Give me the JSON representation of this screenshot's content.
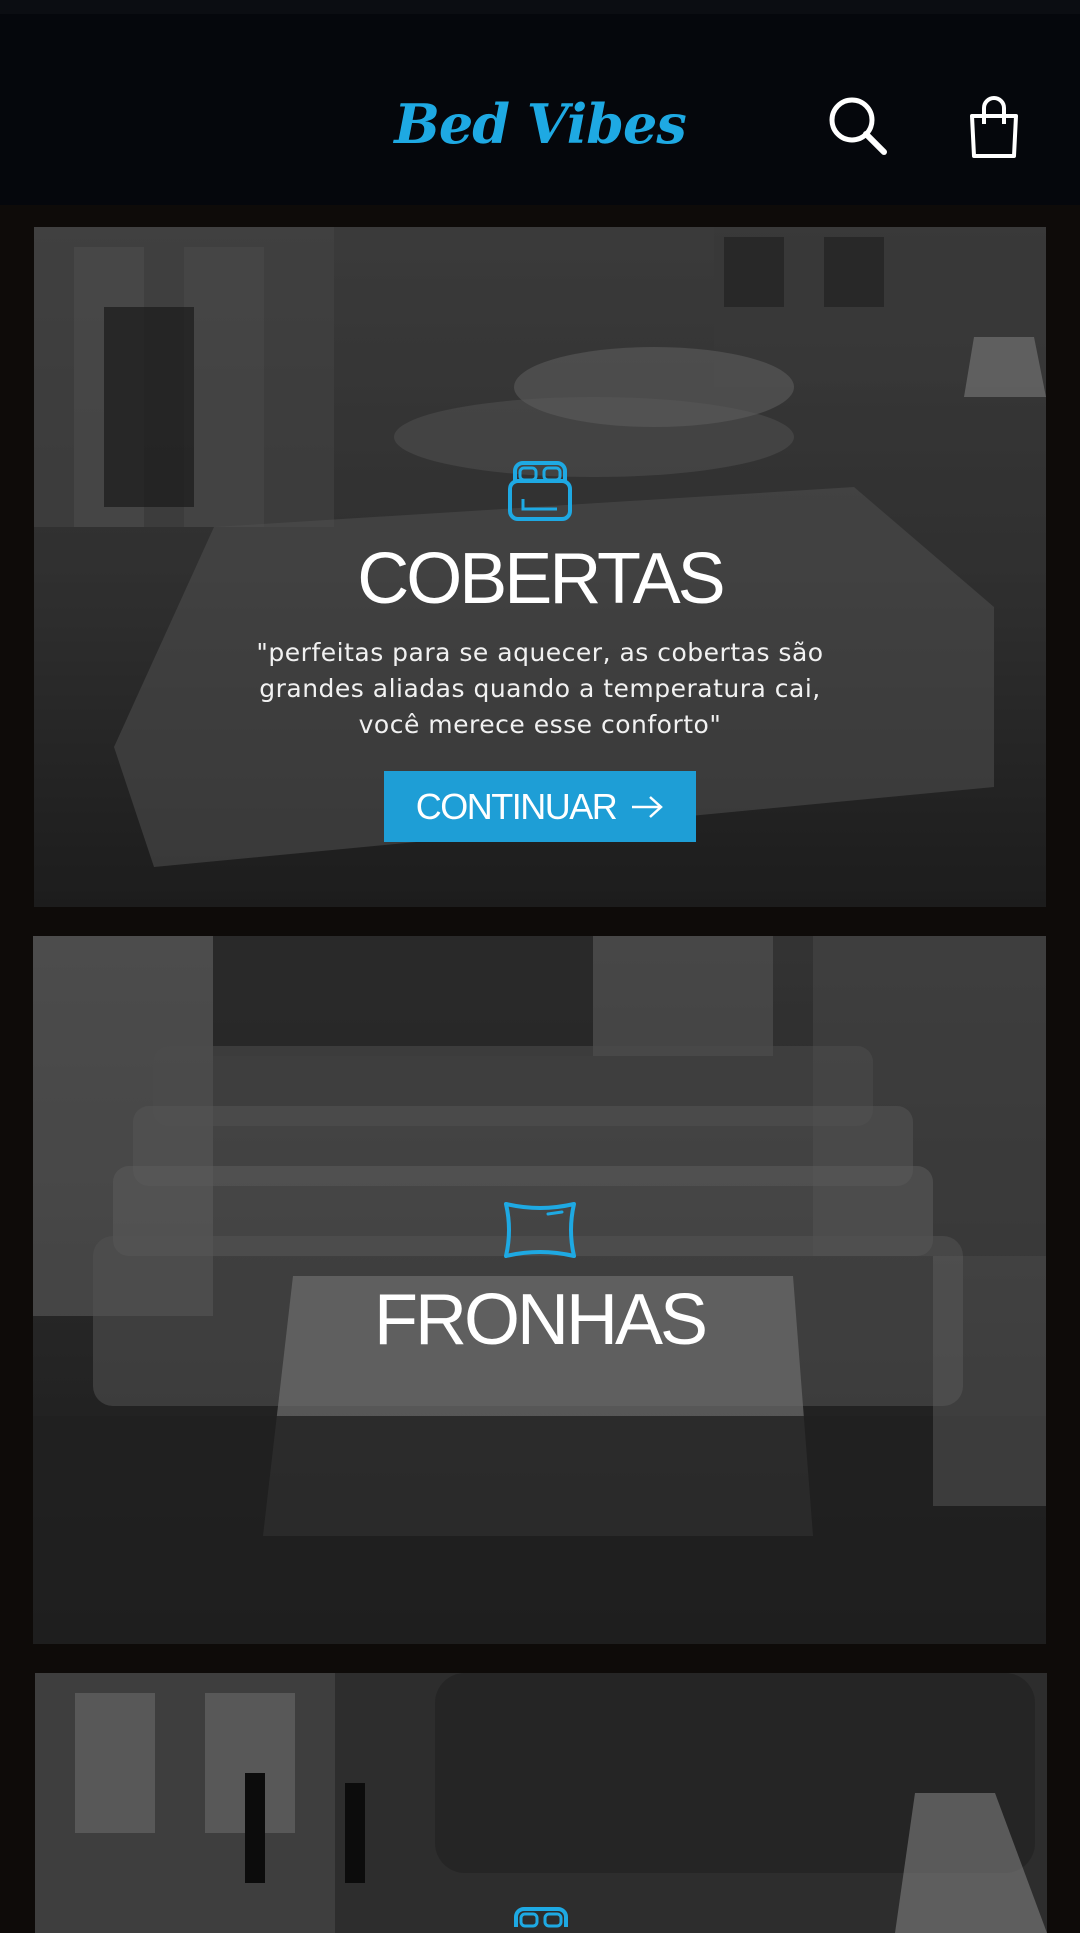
{
  "header": {
    "brand": "Bed Vibes",
    "search_icon": "search-icon",
    "cart_icon": "shopping-bag-icon"
  },
  "colors": {
    "accent": "#1ea9e3",
    "button": "#1e9ed6",
    "header_bg": "#05070c",
    "page_bg": "#0e0b09"
  },
  "categories": [
    {
      "icon": "bed-icon",
      "title": "COBERTAS",
      "description": "\"perfeitas para se aquecer, as cobertas são grandes aliadas quando a temperatura cai, você merece esse conforto\"",
      "button_label": "CONTINUAR",
      "button_icon": "arrow-right-icon"
    },
    {
      "icon": "pillow-icon",
      "title": "FRONHAS"
    },
    {
      "icon": "bed-icon"
    }
  ]
}
